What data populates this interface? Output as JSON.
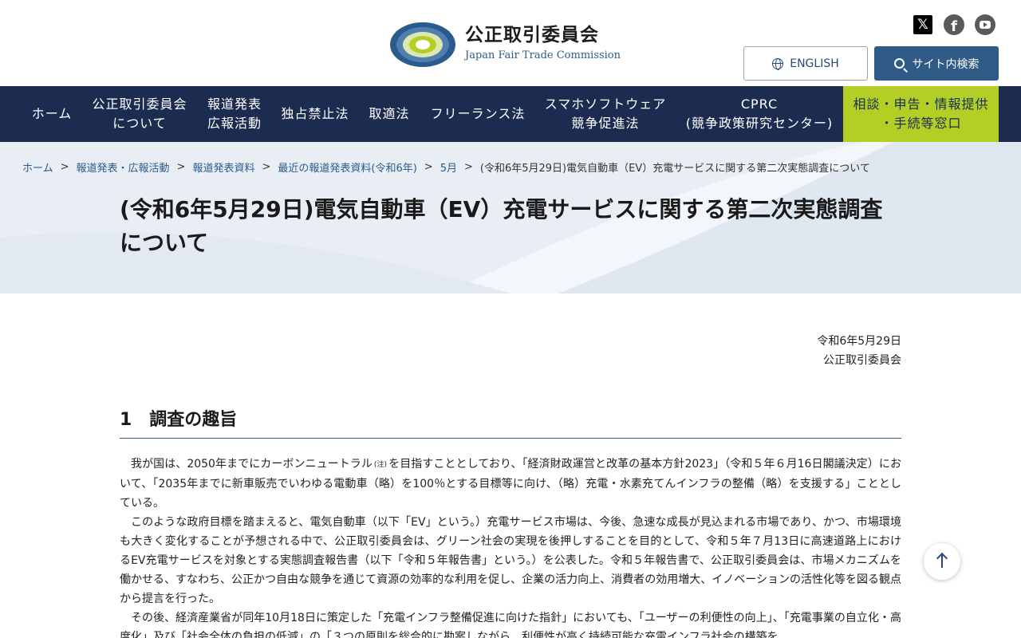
{
  "header": {
    "org_name_jp": "公正取引委員会",
    "org_name_en": "Japan Fair Trade Commission",
    "logo_ring_text": "JAPAN FAIR TRADE COMMISSION",
    "social": [
      "x-icon",
      "facebook-icon",
      "youtube-icon"
    ],
    "english_label": "ENGLISH",
    "search_label": "サイト内検索"
  },
  "nav": {
    "items": [
      {
        "label": "ホーム"
      },
      {
        "label": "公正取引委員会\nについて"
      },
      {
        "label": "報道発表\n広報活動"
      },
      {
        "label": "独占禁止法"
      },
      {
        "label": "取適法"
      },
      {
        "label": "フリーランス法"
      },
      {
        "label": "スマホソフトウェア\n競争促進法"
      },
      {
        "label": "CPRC\n(競争政策研究センター)"
      },
      {
        "label": "相談・申告・情報提供\n・手続等窓口"
      }
    ]
  },
  "breadcrumb": {
    "items": [
      {
        "label": "ホーム"
      },
      {
        "label": "報道発表・広報活動"
      },
      {
        "label": "報道発表資料"
      },
      {
        "label": "最近の報道発表資料(令和6年)"
      },
      {
        "label": "5月"
      }
    ],
    "current": "(令和6年5月29日)電気自動車（EV）充電サービスに関する第二次実態調査について",
    "separator": ">"
  },
  "page": {
    "title": "(令和6年5月29日)電気自動車（EV）充電サービスに関する第二次実態調査について",
    "date": "令和6年5月29日",
    "issuer": "公正取引委員会"
  },
  "section1": {
    "heading": "1　調査の趣旨",
    "p1_before_note": "我が国は、2050年までにカーボンニュートラル",
    "p1_note": "(注)",
    "p1_after_note": "を目指すこととしており、「経済財政運営と改革の基本方針2023」（令和５年６月16日閣議決定）において、「2035年までに新車販売でいわゆる電動車（略）を100％とする目標等に向け、（略）充電・水素充てんインフラの整備（略）を支援する」こととしている。",
    "p2": "このような政府目標を踏まえると、電気自動車（以下「EV」という。）充電サービス市場は、今後、急速な成長が見込まれる市場であり、かつ、市場環境も大きく変化することが予想される中で、公正取引委員会は、グリーン社会の実現を後押しすることを目的として、令和５年７月13日に高速道路上におけるEV充電サービスを対象とする実態調査報告書（以下「令和５年報告書」という。）を公表した。令和５年報告書で、公正取引委員会は、市場メカニズムを働かせる、すなわち、公正かつ自由な競争を通じて資源の効率的な利用を促し、企業の活力向上、消費者の効用増大、イノベーションの活性化等を図る観点から提言を行った。",
    "p3": "その後、経済産業省が同年10月18日に策定した「充電インフラ整備促進に向けた指針」においても、「ユーザーの利便性の向上」、「充電事業の自立化・高度化」及び「社会全体の負担の低減」の「３つの原則を総合的に勘案しながら、利便性が高く持続可能な充電インフラ社会の構築を"
  },
  "colors": {
    "nav_bg": "#1c2c50",
    "accent_green": "#b3cf26",
    "link_blue": "#2a5b8c",
    "search_btn": "#2f5b86",
    "hero_bg": "#e9eef5"
  }
}
